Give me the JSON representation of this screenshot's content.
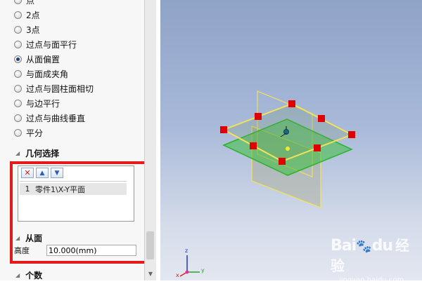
{
  "options": {
    "items": [
      {
        "label": "点",
        "checked": false
      },
      {
        "label": "2点",
        "checked": false
      },
      {
        "label": "3点",
        "checked": false
      },
      {
        "label": "过点与面平行",
        "checked": false
      },
      {
        "label": "从面偏置",
        "checked": true
      },
      {
        "label": "与面成夹角",
        "checked": false
      },
      {
        "label": "过点与圆柱面相切",
        "checked": false
      },
      {
        "label": "与边平行",
        "checked": false
      },
      {
        "label": "过点与曲线垂直",
        "checked": false
      },
      {
        "label": "平分",
        "checked": false
      }
    ]
  },
  "geometry": {
    "title": "几何选择",
    "list": [
      {
        "index": "1",
        "name": "零件1\\X-Y平面"
      }
    ]
  },
  "offset": {
    "title": "从面",
    "height_label": "高度",
    "height_value": "10.000(mm)"
  },
  "count": {
    "title": "个数"
  },
  "axis": {
    "x": "x",
    "y": "y",
    "z": "z"
  },
  "watermark": {
    "logo": "Bai",
    "logo2": "du",
    "brand": "经验",
    "url": "jingyan.baidu.com"
  },
  "colors": {
    "highlight_frame": "#e41a1a",
    "plane_green": "#3dbf3d",
    "plane_yellow": "#f2e25a",
    "handle_red": "#e00000"
  }
}
